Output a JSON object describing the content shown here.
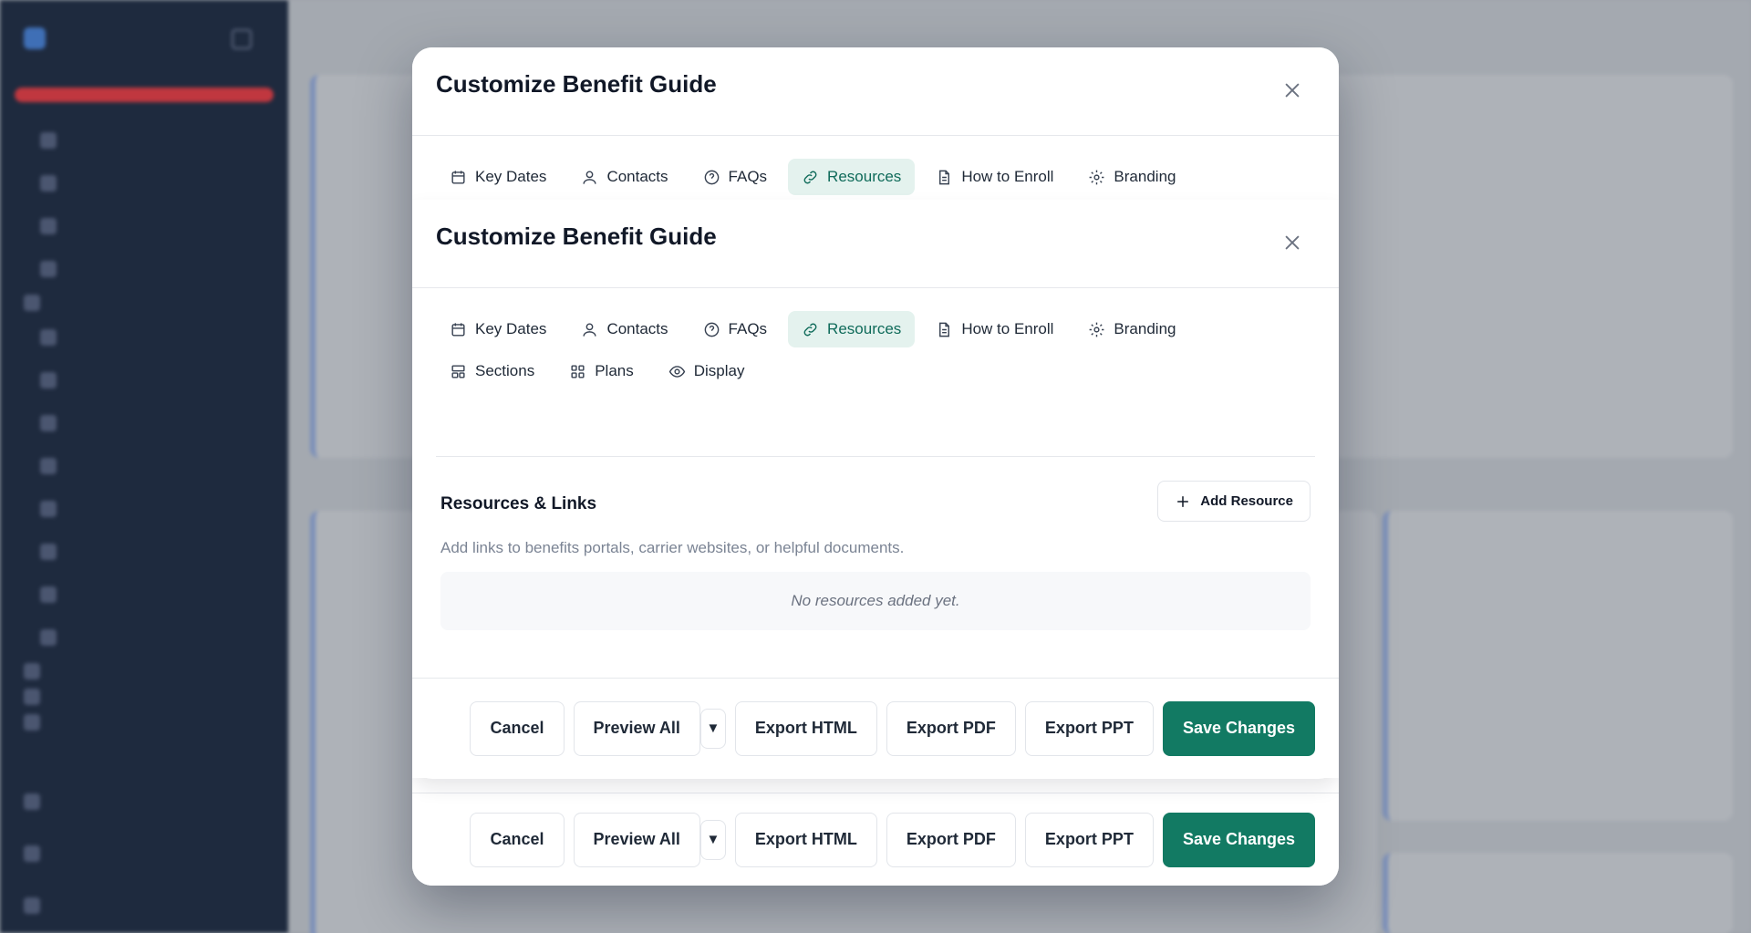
{
  "modal": {
    "title": "Customize Benefit Guide",
    "tabs": [
      {
        "label": "Key Dates",
        "icon": "calendar-icon"
      },
      {
        "label": "Contacts",
        "icon": "user-icon"
      },
      {
        "label": "FAQs",
        "icon": "help-circle-icon"
      },
      {
        "label": "Resources",
        "icon": "link-icon",
        "active": true
      },
      {
        "label": "How to Enroll",
        "icon": "document-icon"
      },
      {
        "label": "Branding",
        "icon": "gear-icon"
      },
      {
        "label": "Sections",
        "icon": "layout-icon"
      },
      {
        "label": "Plans",
        "icon": "grid-icon"
      },
      {
        "label": "Display",
        "icon": "eye-icon"
      }
    ],
    "resources": {
      "title": "Resources & Links",
      "add_label": "Add Resource",
      "description": "Add links to benefits portals, carrier websites, or helpful documents.",
      "empty_text": "No resources added yet."
    },
    "footer": {
      "cancel": "Cancel",
      "preview_all": "Preview All",
      "caret": "▼",
      "export_html": "Export HTML",
      "export_pdf": "Export PDF",
      "export_ppt": "Export PPT",
      "save": "Save Changes"
    }
  },
  "colors": {
    "accent": "#127a63",
    "active_tab_bg": "#e4f2ee",
    "sidebar_bg": "#1e2a3e",
    "alert_bar": "#c0373f"
  }
}
